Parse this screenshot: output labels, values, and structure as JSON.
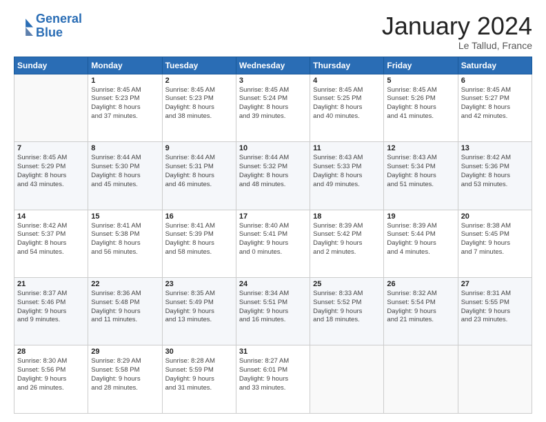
{
  "header": {
    "logo_line1": "General",
    "logo_line2": "Blue",
    "title": "January 2024",
    "location": "Le Tallud, France"
  },
  "weekdays": [
    "Sunday",
    "Monday",
    "Tuesday",
    "Wednesday",
    "Thursday",
    "Friday",
    "Saturday"
  ],
  "weeks": [
    [
      {
        "day": "",
        "sunrise": "",
        "sunset": "",
        "daylight": "",
        "empty": true
      },
      {
        "day": "1",
        "sunrise": "8:45 AM",
        "sunset": "5:23 PM",
        "daylight": "8 hours and 37 minutes."
      },
      {
        "day": "2",
        "sunrise": "8:45 AM",
        "sunset": "5:23 PM",
        "daylight": "8 hours and 38 minutes."
      },
      {
        "day": "3",
        "sunrise": "8:45 AM",
        "sunset": "5:24 PM",
        "daylight": "8 hours and 39 minutes."
      },
      {
        "day": "4",
        "sunrise": "8:45 AM",
        "sunset": "5:25 PM",
        "daylight": "8 hours and 40 minutes."
      },
      {
        "day": "5",
        "sunrise": "8:45 AM",
        "sunset": "5:26 PM",
        "daylight": "8 hours and 41 minutes."
      },
      {
        "day": "6",
        "sunrise": "8:45 AM",
        "sunset": "5:27 PM",
        "daylight": "8 hours and 42 minutes."
      }
    ],
    [
      {
        "day": "7",
        "sunrise": "8:45 AM",
        "sunset": "5:29 PM",
        "daylight": "8 hours and 43 minutes."
      },
      {
        "day": "8",
        "sunrise": "8:44 AM",
        "sunset": "5:30 PM",
        "daylight": "8 hours and 45 minutes."
      },
      {
        "day": "9",
        "sunrise": "8:44 AM",
        "sunset": "5:31 PM",
        "daylight": "8 hours and 46 minutes."
      },
      {
        "day": "10",
        "sunrise": "8:44 AM",
        "sunset": "5:32 PM",
        "daylight": "8 hours and 48 minutes."
      },
      {
        "day": "11",
        "sunrise": "8:43 AM",
        "sunset": "5:33 PM",
        "daylight": "8 hours and 49 minutes."
      },
      {
        "day": "12",
        "sunrise": "8:43 AM",
        "sunset": "5:34 PM",
        "daylight": "8 hours and 51 minutes."
      },
      {
        "day": "13",
        "sunrise": "8:42 AM",
        "sunset": "5:36 PM",
        "daylight": "8 hours and 53 minutes."
      }
    ],
    [
      {
        "day": "14",
        "sunrise": "8:42 AM",
        "sunset": "5:37 PM",
        "daylight": "8 hours and 54 minutes."
      },
      {
        "day": "15",
        "sunrise": "8:41 AM",
        "sunset": "5:38 PM",
        "daylight": "8 hours and 56 minutes."
      },
      {
        "day": "16",
        "sunrise": "8:41 AM",
        "sunset": "5:39 PM",
        "daylight": "8 hours and 58 minutes."
      },
      {
        "day": "17",
        "sunrise": "8:40 AM",
        "sunset": "5:41 PM",
        "daylight": "9 hours and 0 minutes."
      },
      {
        "day": "18",
        "sunrise": "8:39 AM",
        "sunset": "5:42 PM",
        "daylight": "9 hours and 2 minutes."
      },
      {
        "day": "19",
        "sunrise": "8:39 AM",
        "sunset": "5:44 PM",
        "daylight": "9 hours and 4 minutes."
      },
      {
        "day": "20",
        "sunrise": "8:38 AM",
        "sunset": "5:45 PM",
        "daylight": "9 hours and 7 minutes."
      }
    ],
    [
      {
        "day": "21",
        "sunrise": "8:37 AM",
        "sunset": "5:46 PM",
        "daylight": "9 hours and 9 minutes."
      },
      {
        "day": "22",
        "sunrise": "8:36 AM",
        "sunset": "5:48 PM",
        "daylight": "9 hours and 11 minutes."
      },
      {
        "day": "23",
        "sunrise": "8:35 AM",
        "sunset": "5:49 PM",
        "daylight": "9 hours and 13 minutes."
      },
      {
        "day": "24",
        "sunrise": "8:34 AM",
        "sunset": "5:51 PM",
        "daylight": "9 hours and 16 minutes."
      },
      {
        "day": "25",
        "sunrise": "8:33 AM",
        "sunset": "5:52 PM",
        "daylight": "9 hours and 18 minutes."
      },
      {
        "day": "26",
        "sunrise": "8:32 AM",
        "sunset": "5:54 PM",
        "daylight": "9 hours and 21 minutes."
      },
      {
        "day": "27",
        "sunrise": "8:31 AM",
        "sunset": "5:55 PM",
        "daylight": "9 hours and 23 minutes."
      }
    ],
    [
      {
        "day": "28",
        "sunrise": "8:30 AM",
        "sunset": "5:56 PM",
        "daylight": "9 hours and 26 minutes."
      },
      {
        "day": "29",
        "sunrise": "8:29 AM",
        "sunset": "5:58 PM",
        "daylight": "9 hours and 28 minutes."
      },
      {
        "day": "30",
        "sunrise": "8:28 AM",
        "sunset": "5:59 PM",
        "daylight": "9 hours and 31 minutes."
      },
      {
        "day": "31",
        "sunrise": "8:27 AM",
        "sunset": "6:01 PM",
        "daylight": "9 hours and 33 minutes."
      },
      {
        "day": "",
        "sunrise": "",
        "sunset": "",
        "daylight": "",
        "empty": true
      },
      {
        "day": "",
        "sunrise": "",
        "sunset": "",
        "daylight": "",
        "empty": true
      },
      {
        "day": "",
        "sunrise": "",
        "sunset": "",
        "daylight": "",
        "empty": true
      }
    ]
  ]
}
